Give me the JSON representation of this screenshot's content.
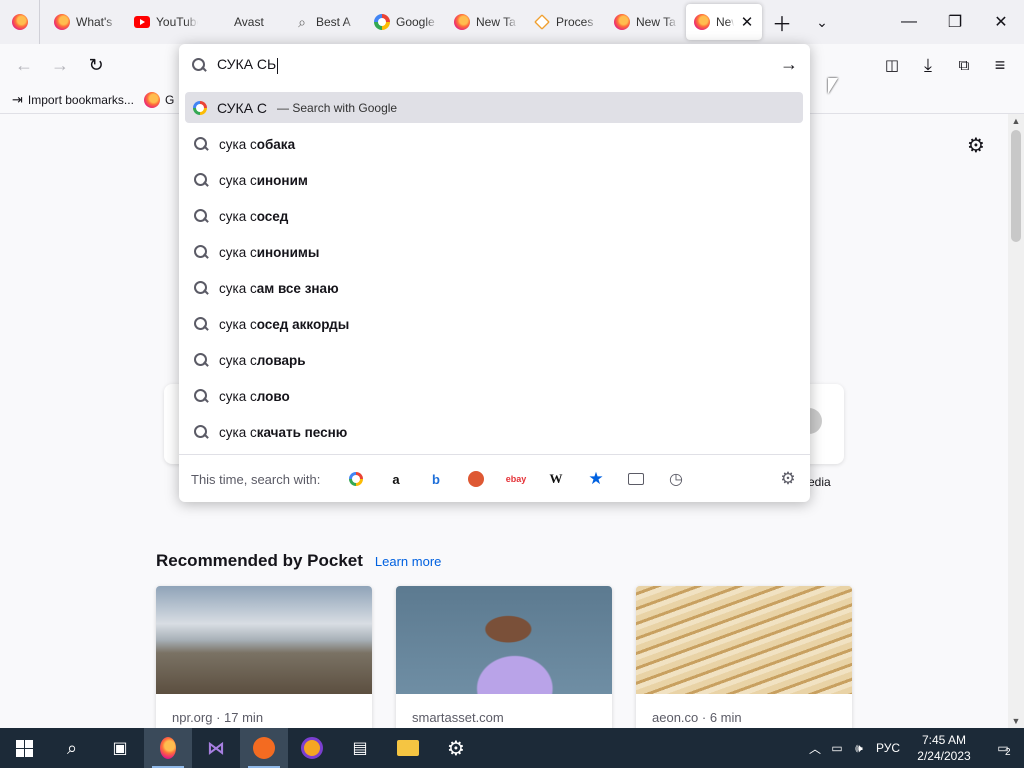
{
  "tabs": [
    {
      "label": "What's",
      "icon": "firefox-icon"
    },
    {
      "label": "YouTube",
      "icon": "youtube-icon"
    },
    {
      "label": "Avast",
      "icon": "none"
    },
    {
      "label": "Best A",
      "icon": "search-icon"
    },
    {
      "label": "Google",
      "icon": "chrome-icon"
    },
    {
      "label": "New Ta",
      "icon": "firefox-icon"
    },
    {
      "label": "Proces",
      "icon": "process-icon"
    },
    {
      "label": "New Ta",
      "icon": "firefox-icon"
    },
    {
      "label": "New",
      "icon": "firefox-icon",
      "active": true
    }
  ],
  "urlbar": {
    "value": "СУКА СЬ",
    "first_result": "СУКА С",
    "first_result_hint": "— Search with Google",
    "suggestions": [
      {
        "prefix": "сука с",
        "rest": "обака"
      },
      {
        "prefix": "сука с",
        "rest": "иноним"
      },
      {
        "prefix": "сука с",
        "rest": "осед"
      },
      {
        "prefix": "сука с",
        "rest": "инонимы"
      },
      {
        "prefix": "сука с",
        "rest": "ам все знаю"
      },
      {
        "prefix": "сука с",
        "rest": "осед аккорды"
      },
      {
        "prefix": "сука с",
        "rest": "ловарь"
      },
      {
        "prefix": "сука с",
        "rest": "лово"
      },
      {
        "prefix": "сука с",
        "rest": "качать песню"
      }
    ],
    "oneoff_label": "This time, search with:"
  },
  "bookmarks": {
    "import_label": "Import bookmarks...",
    "second_label": "G"
  },
  "page": {
    "rec_title": "Recommended by Pocket",
    "learn_more": "Learn more",
    "side_label": "edia",
    "cards": [
      {
        "source": "npr.org · 17 min"
      },
      {
        "source": "smartasset.com"
      },
      {
        "source": "aeon.co · 6 min"
      }
    ]
  },
  "taskbar": {
    "lang": "РУС",
    "time": "7:45 AM",
    "date": "2/24/2023",
    "notif_count": "2"
  },
  "colors": {
    "accent": "#0061e0",
    "taskbar": "#1c2a38"
  }
}
